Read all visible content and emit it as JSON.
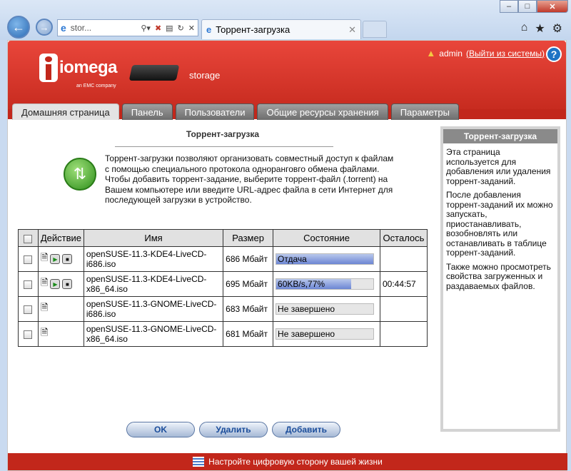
{
  "browser": {
    "address_url": "stor...",
    "tab_title": "Торрент-загрузка"
  },
  "header": {
    "user": "admin",
    "logout_link": "(Выйти из системы)",
    "logo_text": "iomega",
    "logo_sub": "an EMC company",
    "device_name": "storage"
  },
  "nav": {
    "tabs": [
      "Домашняя страница",
      "Панель",
      "Пользователи",
      "Общие ресурсы хранения",
      "Параметры"
    ]
  },
  "main": {
    "title": "Торрент-загрузка",
    "intro": "Торрент-загрузки позволяют организовать совместный доступ к файлам с помощью специального протокола одноранговго обмена файлами. Чтобы добавить торрент-задание, выберите торрент-файл (.torrent) на Вашем компьютере или введите URL-адрес файла в сети Интернет для последующей загрузки в устройство.",
    "columns": [
      "Действие",
      "Имя",
      "Размер",
      "Состояние",
      "Осталось"
    ],
    "rows": [
      {
        "name": "openSUSE-11.3-KDE4-LiveCD-i686.iso",
        "size": "686 Мбайт",
        "status": "Отдача",
        "progress": 1.0,
        "remaining": ""
      },
      {
        "name": "openSUSE-11.3-KDE4-LiveCD-x86_64.iso",
        "size": "695 Мбайт",
        "status": "60KB/s,77%",
        "progress": 0.77,
        "remaining": "00:44:57"
      },
      {
        "name": "openSUSE-11.3-GNOME-LiveCD-i686.iso",
        "size": "683 Мбайт",
        "status": "Не завершено",
        "progress": 0,
        "remaining": ""
      },
      {
        "name": "openSUSE-11.3-GNOME-LiveCD-x86_64.iso",
        "size": "681 Мбайт",
        "status": "Не завершено",
        "progress": 0,
        "remaining": ""
      }
    ],
    "buttons": {
      "ok": "OK",
      "delete": "Удалить",
      "add": "Добавить"
    }
  },
  "sidebar": {
    "title": "Торрент-загрузка",
    "p1": "Эта страница используется для добавления или удаления торрент-заданий.",
    "p2": "После добавления торрент-заданий их можно запускать, приостанавливать, возобновлять или останавливать в таблице торрент-заданий.",
    "p3": "Также можно просмотреть свойства загруженных и раздаваемых файлов."
  },
  "footer": {
    "text": "Настройте цифровую сторону вашей жизни"
  }
}
